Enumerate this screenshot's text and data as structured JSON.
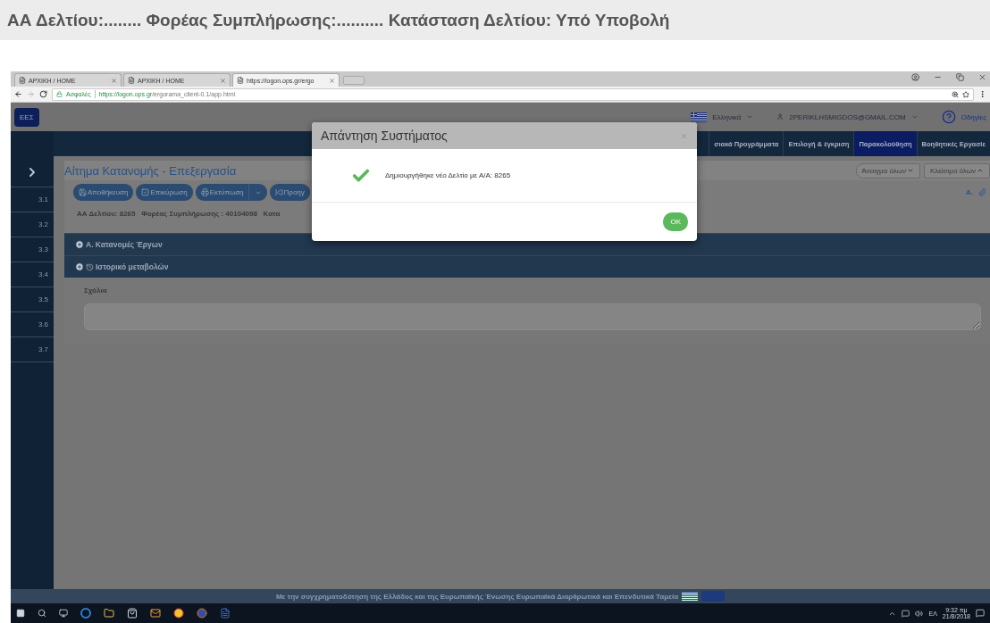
{
  "document_heading": "ΑΑ Δελτίου:........ Φορέας Συμπλήρωσης:.......... Κατάσταση Δελτίου: Υπό Υποβολή",
  "browser": {
    "tabs": [
      {
        "title": "ΑΡΧΙΚΗ / HOME",
        "selected": false
      },
      {
        "title": "ΑΡΧΙΚΗ / HOME",
        "selected": false
      },
      {
        "title": "https://logon.ops.gr/ergo",
        "selected": true
      }
    ],
    "security_label": "Ασφαλές",
    "url_host": "https://logon.ops.gr",
    "url_path": "/ergorama_client-0.1/app.html"
  },
  "app": {
    "logo": "ΕΕΣ",
    "language": "Ελληνικά",
    "user": "2PERIKLHSMIGDOS@GMAIL.COM",
    "help": "Οδηγίες",
    "nav": [
      {
        "label": "σιακά Προγράμματα",
        "selected": false
      },
      {
        "label": "Επιλογή & έγκριση",
        "selected": false
      },
      {
        "label": "Παρακολούθηση",
        "selected": true
      },
      {
        "label": "Βοηθητικές Εργασίε",
        "selected": false
      }
    ],
    "sidebar": [
      "3.1",
      "3.2",
      "3.3",
      "3.4",
      "3.5",
      "3.6",
      "3.7"
    ],
    "page_title": "Αίτημα Κατανομής - Επεξεργασία",
    "toolbar": [
      {
        "label": "Αποθήκευση",
        "kind": "button"
      },
      {
        "label": "Επικύρωση",
        "kind": "button"
      },
      {
        "label": "Εκτύπωση",
        "kind": "split"
      },
      {
        "label": "Προηγ",
        "kind": "button"
      }
    ],
    "expand_all": "Άνοιγμα όλων",
    "collapse_all": "Κλείσιμο όλων",
    "side_tool": "A.",
    "info": "ΑΑ Δελτίου: 8265   Φορέας Συμπλήρωσης : 40104098   Κατα",
    "sections": [
      {
        "label": "Α. Κατανομές Έργων",
        "kind": "plain"
      },
      {
        "label": "Ιστορικό μεταβολών",
        "kind": "history"
      }
    ],
    "comments_label": "Σχόλια"
  },
  "dialog": {
    "title": "Απάντηση Συστήματος",
    "message": "Δημιουργήθηκε νέο Δελτίο με Α/Α: 8265",
    "ok": "OK"
  },
  "footer": "Με την συγχρηματοδότηση της Ελλάδος και της Ευρωπαϊκής Ένωσης Ευρωπαϊκά Διαρθρωτικά και Επενδυτικά Ταμεία",
  "taskbar": {
    "language": "ΕΛ",
    "time": "9:32 πμ",
    "date": "21/8/2018"
  }
}
